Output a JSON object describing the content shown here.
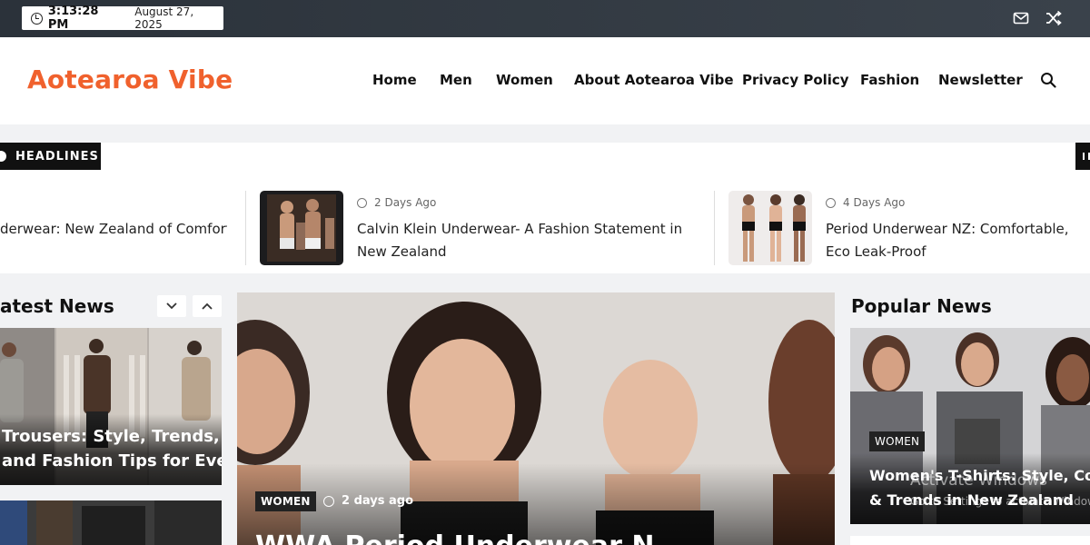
{
  "topbar": {
    "time": "3:13:28 PM",
    "date": "August 27, 2025",
    "icons": [
      "clock-icon",
      "mail-icon",
      "shuffle-icon"
    ]
  },
  "header": {
    "logo": "Aotearoa Vibe",
    "logo_color": "#f0612d",
    "nav": [
      "Home",
      "Men",
      "Women",
      "About Aotearoa Vibe",
      "Privacy Policy",
      "Fashion",
      "Newsletter"
    ]
  },
  "headlines": {
    "label": "HEADLINES",
    "items": [
      {
        "title": "derwear: New Zealand of Comfort"
      },
      {
        "time": "2 Days Ago",
        "title": "Calvin Klein Underwear- A Fashion Statement in New Zealand"
      },
      {
        "time": "4 Days Ago",
        "title": "Period Underwear NZ: Comfortable, Eco Leak-Proof"
      }
    ]
  },
  "latest": {
    "title": "atest News",
    "cards": [
      {
        "title_line1": "Trousers: Style, Trends,",
        "title_line2": "and Fashion Tips for Eve"
      }
    ]
  },
  "featured": {
    "category": "WOMEN",
    "time": "2 days ago",
    "title": "WWA Period Underwear N"
  },
  "popular": {
    "title": "Popular News",
    "cards": [
      {
        "category": "WOMEN",
        "title_line1": "Women's T-Shirts: Style, Comfort",
        "title_line2": "& Trends in New Zealand"
      }
    ]
  },
  "watermark": {
    "line1": "Activate Windows",
    "line2": "Go to Settings to activate Windows."
  }
}
